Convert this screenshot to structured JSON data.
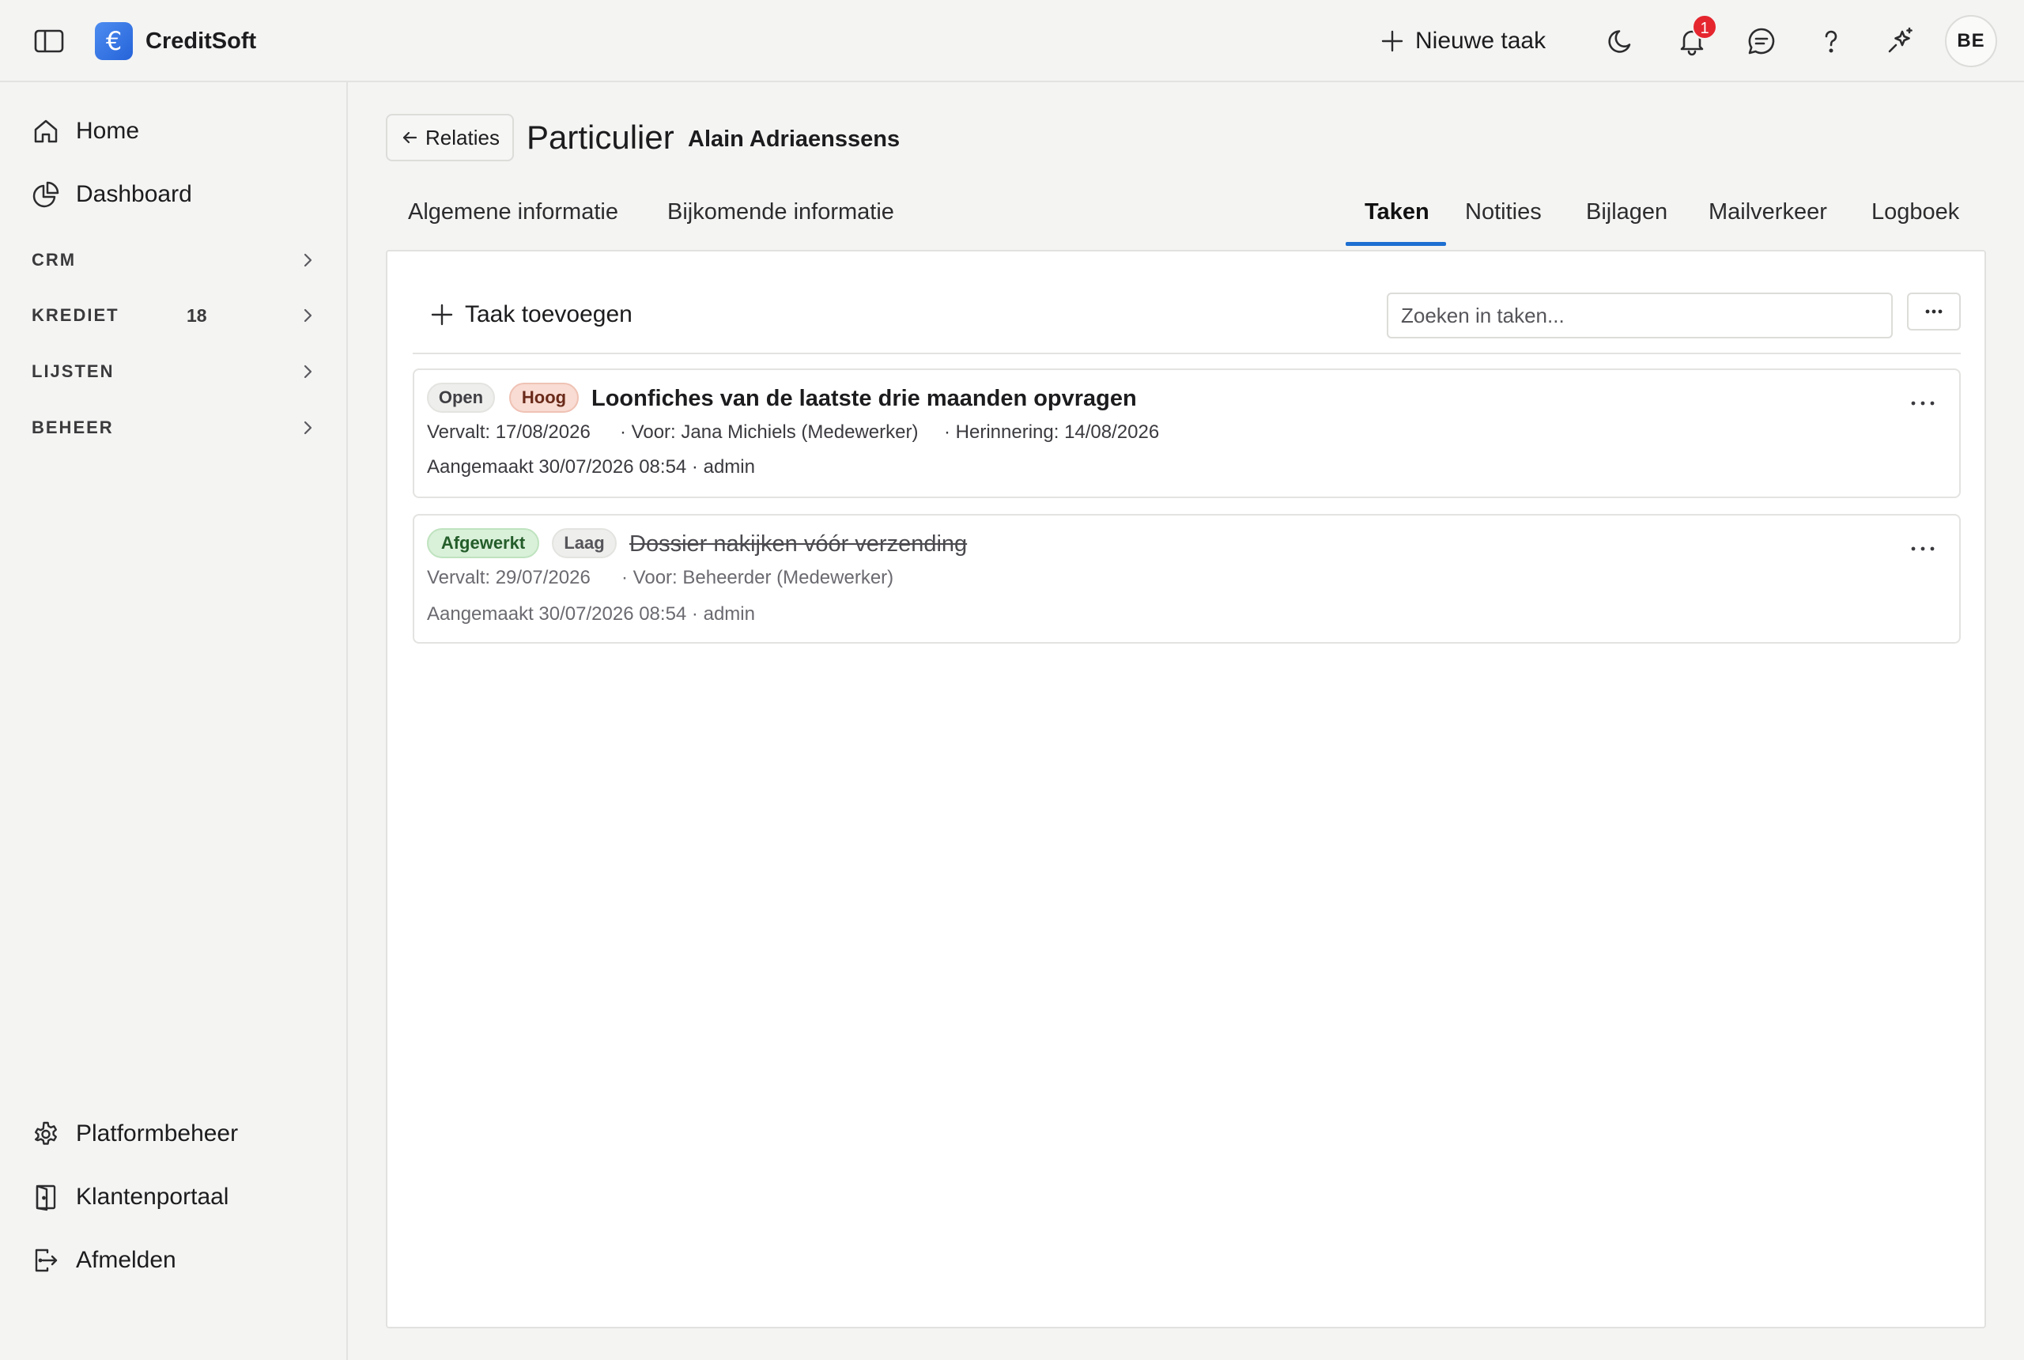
{
  "header": {
    "brand_name": "CreditSoft",
    "brand_symbol": "€",
    "new_task_label": "Nieuwe taak",
    "notification_count": "1",
    "avatar_initials": "BE",
    "accent_color": "#1d6fd1"
  },
  "sidebar": {
    "top_items": [
      {
        "label": "Home",
        "icon": "home-icon"
      },
      {
        "label": "Dashboard",
        "icon": "pie-chart-icon"
      }
    ],
    "sections": [
      {
        "label": "CRM",
        "count": ""
      },
      {
        "label": "KREDIET",
        "count": "18"
      },
      {
        "label": "LIJSTEN",
        "count": ""
      },
      {
        "label": "BEHEER",
        "count": ""
      }
    ],
    "bottom_items": [
      {
        "label": "Platformbeheer",
        "icon": "gear-icon"
      },
      {
        "label": "Klantenportaal",
        "icon": "door-icon"
      },
      {
        "label": "Afmelden",
        "icon": "logout-icon"
      }
    ]
  },
  "page": {
    "back_label": "Relaties",
    "title": "Particulier",
    "subtitle": "Alain Adriaenssens"
  },
  "tabs": {
    "left": [
      "Algemene informatie",
      "Bijkomende informatie"
    ],
    "right": [
      "Taken",
      "Notities",
      "Bijlagen",
      "Mailverkeer",
      "Logboek"
    ],
    "active": "Taken"
  },
  "tasks_panel": {
    "add_label": "Taak toevoegen",
    "search_placeholder": "Zoeken in taken...",
    "more_label": "···",
    "tasks": [
      {
        "status": "Open",
        "priority": "Hoog",
        "title": "Loonfiches van de laatste drie maanden opvragen",
        "due": "Vervalt: 17/08/2026",
        "assignee": "· Voor: Jana Michiels (Medewerker)",
        "reminder": "· Herinnering: 14/08/2026",
        "created": "Aangemaakt 30/07/2026 08:54 · admin",
        "completed": false
      },
      {
        "status": "Afgewerkt",
        "priority": "Laag",
        "title": "Dossier nakijken vóór verzending",
        "due": "Vervalt: 29/07/2026",
        "assignee": "· Voor: Beheerder (Medewerker)",
        "reminder": "",
        "created": "Aangemaakt 30/07/2026 08:54 · admin",
        "completed": true
      }
    ]
  }
}
